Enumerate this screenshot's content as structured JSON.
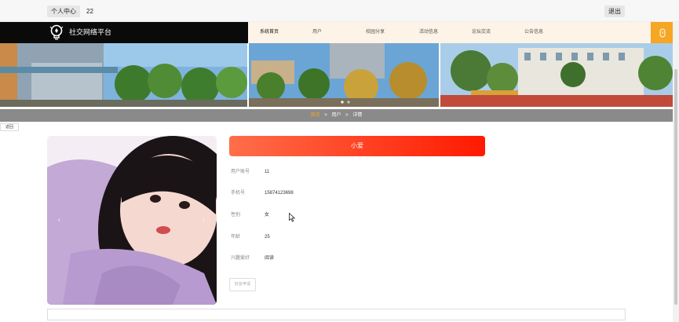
{
  "topbar": {
    "personal_center": "个人中心",
    "user_id": "22",
    "logout": "退出"
  },
  "header": {
    "site_title": "社交网络平台",
    "nav": [
      "系统首页",
      "用户",
      "校园分享",
      "活动信息",
      "论坛交流",
      "公告信息"
    ],
    "active_nav": "系统首页"
  },
  "breadcrumb": {
    "home": "首页",
    "sep1": ">",
    "section": "用户",
    "sep2": ">",
    "current": "详情"
  },
  "back_label": "返回",
  "profile": {
    "name": "小爱",
    "fields": [
      {
        "label": "用户账号",
        "value": "11"
      },
      {
        "label": "手机号",
        "value": "15874123698"
      },
      {
        "label": "性别",
        "value": "女"
      },
      {
        "label": "年龄",
        "value": "25"
      },
      {
        "label": "兴趣爱好",
        "value": "阅读"
      }
    ],
    "add_friend": "好友申请"
  },
  "colors": {
    "accent": "#f5a623",
    "name_gradient_start": "#ff6e4a",
    "name_gradient_end": "#ff1a00",
    "brand_bg": "#0a0a0a"
  }
}
